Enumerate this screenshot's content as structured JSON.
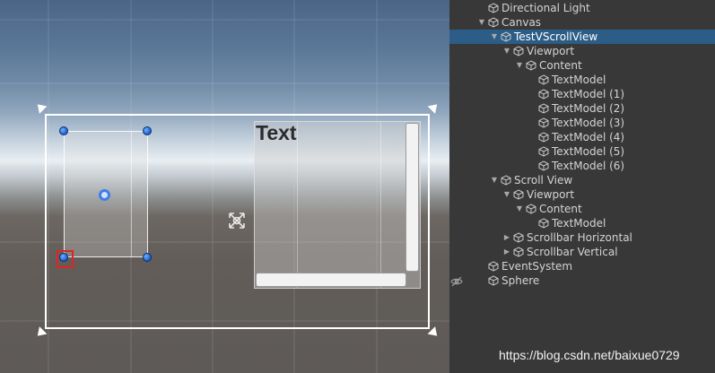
{
  "scene": {
    "text_label": "Text"
  },
  "hierarchy": {
    "items": [
      {
        "label": "Directional Light",
        "depth": 2,
        "arrow": "none",
        "selected": false
      },
      {
        "label": "Canvas",
        "depth": 2,
        "arrow": "down",
        "selected": false
      },
      {
        "label": "TestVScrollView",
        "depth": 3,
        "arrow": "down",
        "selected": true
      },
      {
        "label": "Viewport",
        "depth": 4,
        "arrow": "down",
        "selected": false
      },
      {
        "label": "Content",
        "depth": 5,
        "arrow": "down",
        "selected": false
      },
      {
        "label": "TextModel",
        "depth": 6,
        "arrow": "none",
        "selected": false
      },
      {
        "label": "TextModel (1)",
        "depth": 6,
        "arrow": "none",
        "selected": false
      },
      {
        "label": "TextModel (2)",
        "depth": 6,
        "arrow": "none",
        "selected": false
      },
      {
        "label": "TextModel (3)",
        "depth": 6,
        "arrow": "none",
        "selected": false
      },
      {
        "label": "TextModel (4)",
        "depth": 6,
        "arrow": "none",
        "selected": false
      },
      {
        "label": "TextModel (5)",
        "depth": 6,
        "arrow": "none",
        "selected": false
      },
      {
        "label": "TextModel (6)",
        "depth": 6,
        "arrow": "none",
        "selected": false
      },
      {
        "label": "Scroll View",
        "depth": 3,
        "arrow": "down",
        "selected": false
      },
      {
        "label": "Viewport",
        "depth": 4,
        "arrow": "down",
        "selected": false
      },
      {
        "label": "Content",
        "depth": 5,
        "arrow": "down",
        "selected": false
      },
      {
        "label": "TextModel",
        "depth": 6,
        "arrow": "none",
        "selected": false
      },
      {
        "label": "Scrollbar Horizontal",
        "depth": 4,
        "arrow": "right",
        "selected": false
      },
      {
        "label": "Scrollbar Vertical",
        "depth": 4,
        "arrow": "right",
        "selected": false
      },
      {
        "label": "EventSystem",
        "depth": 2,
        "arrow": "none",
        "selected": false
      },
      {
        "label": "Sphere",
        "depth": 2,
        "arrow": "none",
        "selected": false
      }
    ]
  },
  "icons": {
    "gameobject": "cube-icon",
    "visibility": "eye-hidden-icon",
    "move": "move-tool-icon"
  },
  "colors": {
    "selection": "#2c5d87",
    "handle": "#1c5fd0",
    "highlight_box": "#e02424"
  },
  "watermark": "https://blog.csdn.net/baixue0729"
}
